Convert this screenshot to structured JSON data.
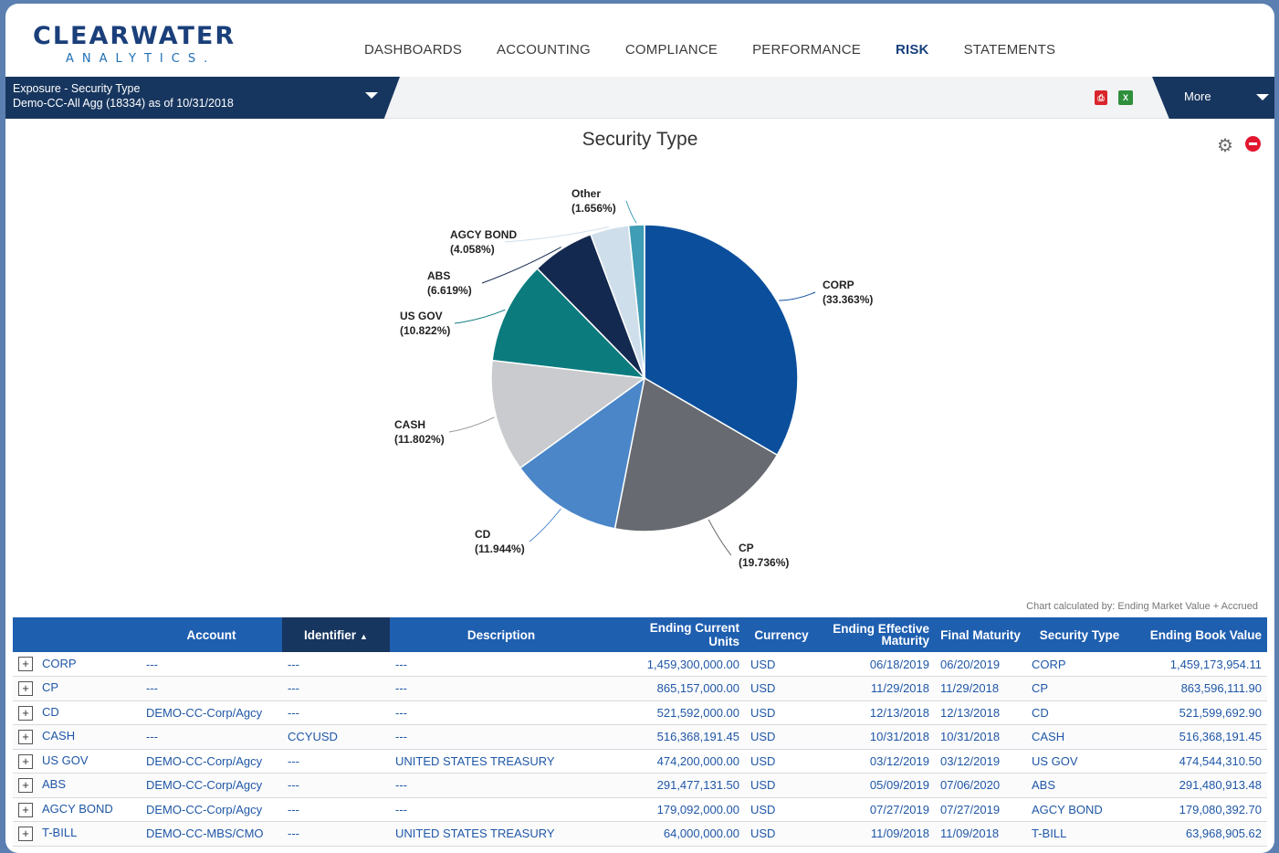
{
  "brand": {
    "name": "CLEARWATER",
    "sub": "ANALYTICS."
  },
  "nav": [
    {
      "label": "DASHBOARDS"
    },
    {
      "label": "ACCOUNTING"
    },
    {
      "label": "COMPLIANCE"
    },
    {
      "label": "PERFORMANCE"
    },
    {
      "label": "RISK",
      "active": true
    },
    {
      "label": "STATEMENTS"
    }
  ],
  "selector": {
    "line1": "Exposure - Security Type",
    "line2": "Demo-CC-All Agg (18334) as of 10/31/2018"
  },
  "more_label": "More",
  "chart_title": "Security Type",
  "calc_note": "Chart calculated by: Ending Market Value + Accrued",
  "chart_data": {
    "type": "pie",
    "title": "Security Type",
    "slices": [
      {
        "label": "CORP",
        "value": 33.363,
        "text": "(33.363%)",
        "color": "#0b4f9c"
      },
      {
        "label": "CP",
        "value": 19.736,
        "text": "(19.736%)",
        "color": "#676a70"
      },
      {
        "label": "CD",
        "value": 11.944,
        "text": "(11.944%)",
        "color": "#4a86c8"
      },
      {
        "label": "CASH",
        "value": 11.802,
        "text": "(11.802%)",
        "color": "#c9cbce"
      },
      {
        "label": "US GOV",
        "value": 10.822,
        "text": "(10.822%)",
        "color": "#0b7b7e"
      },
      {
        "label": "ABS",
        "value": 6.619,
        "text": "(6.619%)",
        "color": "#14294f"
      },
      {
        "label": "AGCY BOND",
        "value": 4.058,
        "text": "(4.058%)",
        "color": "#cfdeeb"
      },
      {
        "label": "Other",
        "value": 1.656,
        "text": "(1.656%)",
        "color": "#3f9db5"
      }
    ]
  },
  "table": {
    "headers": [
      "Account",
      "Identifier",
      "Description",
      "Ending Current Units",
      "Currency",
      "Ending Effective Maturity",
      "Final Maturity",
      "Security Type",
      "Ending Book Value"
    ],
    "rows": [
      {
        "group": "CORP",
        "account": "---",
        "identifier": "---",
        "description": "---",
        "units": "1,459,300,000.00",
        "currency": "USD",
        "eff_maturity": "06/18/2019",
        "final_maturity": "06/20/2019",
        "sec_type": "CORP",
        "book_value": "1,459,173,954.11"
      },
      {
        "group": "CP",
        "account": "---",
        "identifier": "---",
        "description": "---",
        "units": "865,157,000.00",
        "currency": "USD",
        "eff_maturity": "11/29/2018",
        "final_maturity": "11/29/2018",
        "sec_type": "CP",
        "book_value": "863,596,111.90"
      },
      {
        "group": "CD",
        "account": "DEMO-CC-Corp/Agcy",
        "identifier": "---",
        "description": "---",
        "units": "521,592,000.00",
        "currency": "USD",
        "eff_maturity": "12/13/2018",
        "final_maturity": "12/13/2018",
        "sec_type": "CD",
        "book_value": "521,599,692.90"
      },
      {
        "group": "CASH",
        "account": "---",
        "identifier": "CCYUSD",
        "description": "---",
        "units": "516,368,191.45",
        "currency": "USD",
        "eff_maturity": "10/31/2018",
        "final_maturity": "10/31/2018",
        "sec_type": "CASH",
        "book_value": "516,368,191.45"
      },
      {
        "group": "US GOV",
        "account": "DEMO-CC-Corp/Agcy",
        "identifier": "---",
        "description": "UNITED STATES TREASURY",
        "units": "474,200,000.00",
        "currency": "USD",
        "eff_maturity": "03/12/2019",
        "final_maturity": "03/12/2019",
        "sec_type": "US GOV",
        "book_value": "474,544,310.50"
      },
      {
        "group": "ABS",
        "account": "DEMO-CC-Corp/Agcy",
        "identifier": "---",
        "description": "---",
        "units": "291,477,131.50",
        "currency": "USD",
        "eff_maturity": "05/09/2019",
        "final_maturity": "07/06/2020",
        "sec_type": "ABS",
        "book_value": "291,480,913.48"
      },
      {
        "group": "AGCY BOND",
        "account": "DEMO-CC-Corp/Agcy",
        "identifier": "---",
        "description": "---",
        "units": "179,092,000.00",
        "currency": "USD",
        "eff_maturity": "07/27/2019",
        "final_maturity": "07/27/2019",
        "sec_type": "AGCY BOND",
        "book_value": "179,080,392.70"
      },
      {
        "group": "T-BILL",
        "account": "DEMO-CC-MBS/CMO",
        "identifier": "---",
        "description": "UNITED STATES TREASURY",
        "units": "64,000,000.00",
        "currency": "USD",
        "eff_maturity": "11/09/2018",
        "final_maturity": "11/09/2018",
        "sec_type": "T-BILL",
        "book_value": "63,968,905.62"
      }
    ]
  }
}
